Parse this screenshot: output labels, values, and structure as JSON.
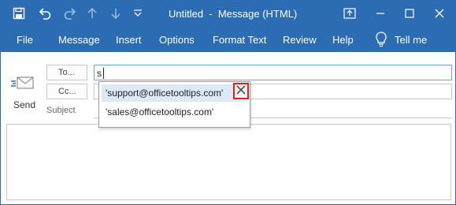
{
  "window": {
    "title": "Untitled  -  Message (HTML)",
    "accent_color": "#2b6cb3",
    "quick_access": [
      "save-icon",
      "undo-icon",
      "redo-icon",
      "up-arrow-icon",
      "down-arrow-icon",
      "customize-icon"
    ],
    "controls": [
      "ribbon-display-icon",
      "minimize-icon",
      "maximize-icon",
      "close-icon"
    ]
  },
  "ribbon": {
    "tabs": [
      {
        "label": "File"
      },
      {
        "label": "Message"
      },
      {
        "label": "Insert"
      },
      {
        "label": "Options"
      },
      {
        "label": "Format Text"
      },
      {
        "label": "Review"
      },
      {
        "label": "Help"
      }
    ],
    "tell_me": "Tell me"
  },
  "compose": {
    "send_label": "Send",
    "to_label": "To...",
    "cc_label": "Cc...",
    "subject_label": "Subject",
    "to_value": "s",
    "cc_value": "",
    "subject_value": ""
  },
  "autocomplete": {
    "items": [
      {
        "text": "'support@officetooltips.com'",
        "selected": true
      },
      {
        "text": "'sales@officetooltips.com'",
        "selected": false
      }
    ],
    "remove_icon": "close-x-icon",
    "highlight_color": "#e02020"
  }
}
